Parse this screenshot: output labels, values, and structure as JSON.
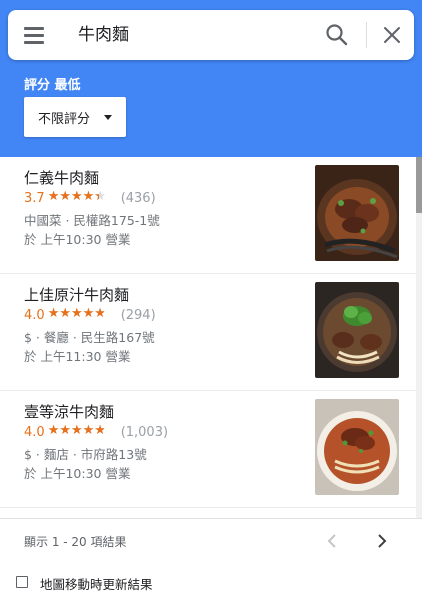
{
  "search": {
    "query": "牛肉麵",
    "menu_icon": "hamburger-menu-icon",
    "search_icon": "magnifier-icon",
    "close_icon": "close-x-icon"
  },
  "filter": {
    "rating_label": "評分 最低",
    "rating_value": "不限評分"
  },
  "colors": {
    "header_bg": "#4285f4",
    "rating_accent": "#e7711b",
    "secondary_text": "#70757a"
  },
  "results": [
    {
      "name": "仁義牛肉麵",
      "rating": "3.7",
      "rating_value": 3.7,
      "reviews": "(436)",
      "detail": "中國菜 · 民權路175-1號",
      "hours": "於 上午10:30 營業",
      "photo_icon": "beef-noodle-photo"
    },
    {
      "name": "上佳原汁牛肉麵",
      "rating": "4.0",
      "rating_value": 4.0,
      "reviews": "(294)",
      "detail": "$ · 餐廳 · 民生路167號",
      "hours": "於 上午11:30 營業",
      "photo_icon": "beef-noodle-photo"
    },
    {
      "name": "壹等涼牛肉麵",
      "rating": "4.0",
      "rating_value": 4.0,
      "reviews": "(1,003)",
      "detail": "$ · 麵店 · 市府路13號",
      "hours": "於 上午10:30 營業",
      "photo_icon": "beef-noodle-photo"
    }
  ],
  "pagination": {
    "summary": "顯示 1 - 20 項結果",
    "prev_icon": "chevron-left-icon",
    "next_icon": "chevron-right-icon"
  },
  "map_update": {
    "label": "地圖移動時更新結果",
    "checked": false
  }
}
